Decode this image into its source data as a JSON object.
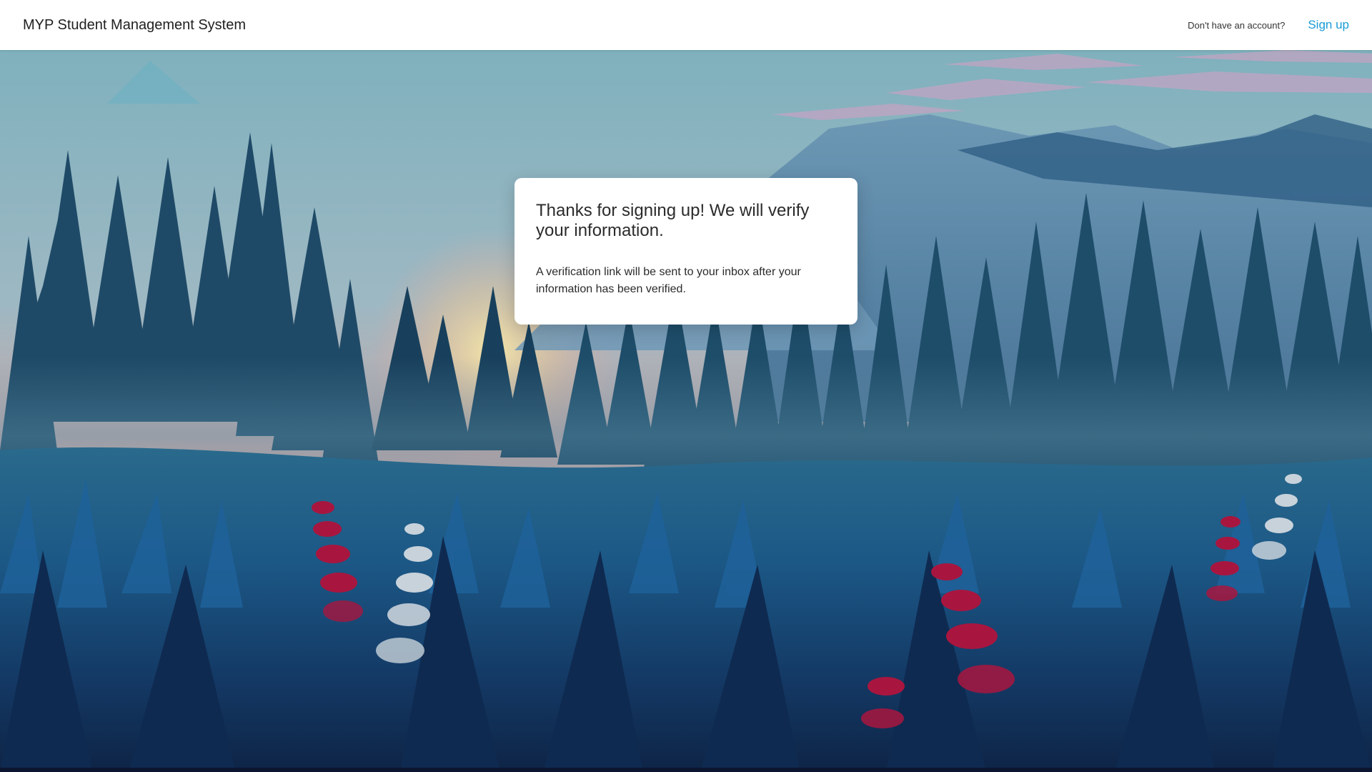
{
  "header": {
    "app_title": "MYP Student Management System",
    "account_question": "Don't have an account?",
    "signup_label": "Sign up"
  },
  "card": {
    "title": "Thanks for signing up! We will verify your information.",
    "body": "A verification link will be sent to your inbox after your information has been verified."
  },
  "colors": {
    "header_bg": "#ffffff",
    "link": "#1a9bd7",
    "sky_top": "#7aaab8",
    "sky_glow": "#e8b49a",
    "forest": "#123a55",
    "grass": "#16507e",
    "flower_red": "#a8163f",
    "flower_white": "#c8d2da"
  },
  "background": {
    "icon": "forest-landscape-illustration"
  }
}
